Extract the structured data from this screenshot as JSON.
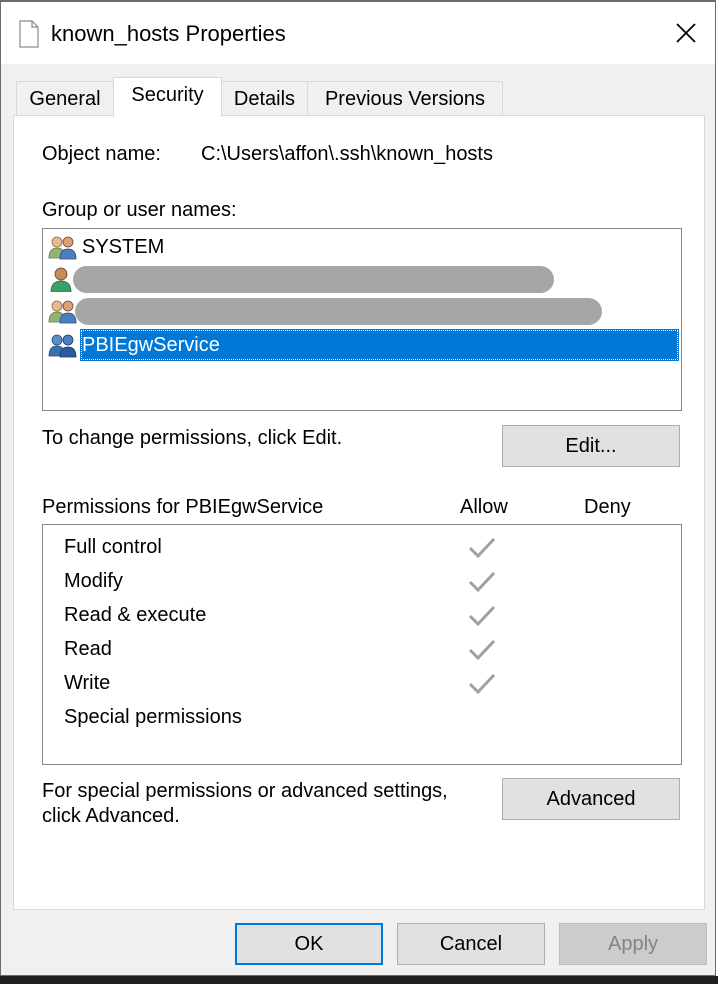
{
  "window": {
    "title": "known_hosts Properties"
  },
  "tabs": [
    {
      "label": "General",
      "active": false
    },
    {
      "label": "Security",
      "active": true
    },
    {
      "label": "Details",
      "active": false
    },
    {
      "label": "Previous Versions",
      "active": false
    }
  ],
  "security": {
    "object_name_label": "Object name:",
    "object_name_value": "C:\\Users\\affon\\.ssh\\known_hosts",
    "group_label": "Group or user names:",
    "users": [
      {
        "label": "SYSTEM",
        "icon": "group-users-icon",
        "redacted": false,
        "selected": false
      },
      {
        "label": "",
        "icon": "single-user-icon",
        "redacted": true,
        "selected": false
      },
      {
        "label": "",
        "icon": "group-users-icon",
        "redacted": true,
        "selected": false
      },
      {
        "label": "PBIEgwService",
        "icon": "group-users-blue-icon",
        "redacted": false,
        "selected": true
      }
    ],
    "change_hint": "To change permissions, click Edit.",
    "edit_button": "Edit...",
    "permissions_for_label": "Permissions for PBIEgwService",
    "allow_header": "Allow",
    "deny_header": "Deny",
    "permissions": [
      {
        "name": "Full control",
        "allow": true,
        "deny": false
      },
      {
        "name": "Modify",
        "allow": true,
        "deny": false
      },
      {
        "name": "Read & execute",
        "allow": true,
        "deny": false
      },
      {
        "name": "Read",
        "allow": true,
        "deny": false
      },
      {
        "name": "Write",
        "allow": true,
        "deny": false
      },
      {
        "name": "Special permissions",
        "allow": false,
        "deny": false
      }
    ],
    "advanced_hint_line1": "For special permissions or advanced settings,",
    "advanced_hint_line2": "click Advanced.",
    "advanced_button": "Advanced"
  },
  "footer": {
    "ok": "OK",
    "cancel": "Cancel",
    "apply": "Apply"
  },
  "colors": {
    "selection": "#0078d7",
    "check_disabled": "#a0a0a0",
    "redaction": "#a6a6a6",
    "focus_border": "#0078d7"
  }
}
